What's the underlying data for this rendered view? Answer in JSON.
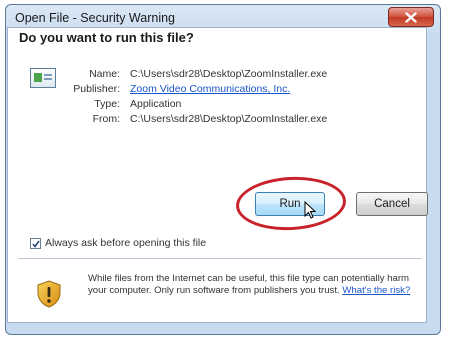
{
  "window": {
    "title": "Open File - Security Warning"
  },
  "dialog": {
    "heading": "Do you want to run this file?",
    "fields": {
      "name_label": "Name:",
      "name_value": "C:\\Users\\sdr28\\Desktop\\ZoomInstaller.exe",
      "publisher_label": "Publisher:",
      "publisher_value": "Zoom Video Communications, Inc.",
      "type_label": "Type:",
      "type_value": "Application",
      "from_label": "From:",
      "from_value": "C:\\Users\\sdr28\\Desktop\\ZoomInstaller.exe"
    },
    "buttons": {
      "run": "Run",
      "cancel": "Cancel"
    },
    "checkbox": {
      "label": "Always ask before opening this file",
      "checked": true
    },
    "footer": {
      "text": "While files from the Internet can be useful, this file type can potentially harm your computer. Only run software from publishers you trust.",
      "link": "What's the risk?"
    }
  },
  "icons": {
    "close": "close-icon",
    "file": "application-file-icon",
    "shield": "warning-shield-icon",
    "cursor": "mouse-cursor-icon",
    "check": "checkmark-icon"
  },
  "colors": {
    "highlight_ring": "#c8222a",
    "link": "#1a56c9",
    "close_button": "#c03a24"
  }
}
